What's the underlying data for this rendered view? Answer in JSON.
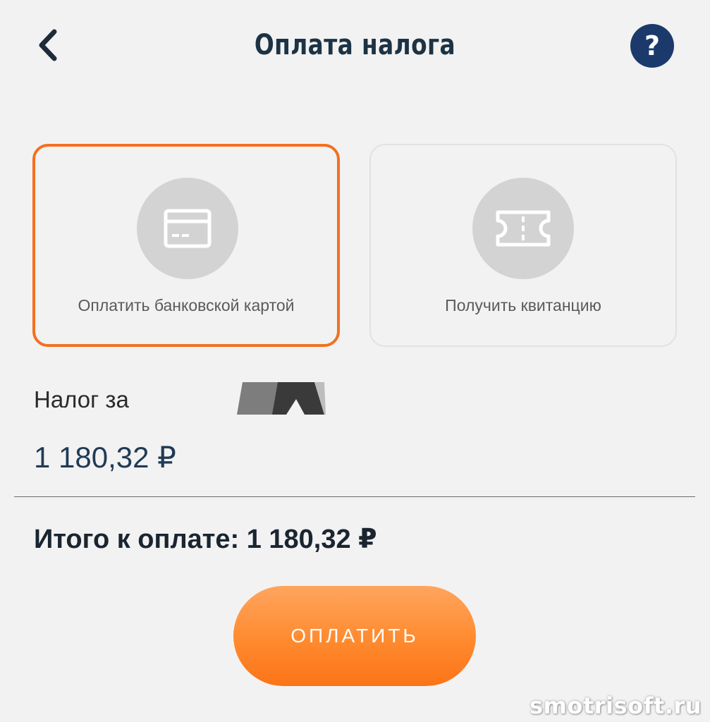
{
  "header": {
    "title": "Оплата налога",
    "help_label": "?"
  },
  "options": [
    {
      "label": "Оплатить банковской картой",
      "icon": "credit-card-icon",
      "selected": true
    },
    {
      "label": "Получить квитанцию",
      "icon": "ticket-icon",
      "selected": false
    }
  ],
  "tax": {
    "label": "Налог за",
    "amount": "1 180,32 ₽"
  },
  "total": {
    "text": "Итого к оплате: 1 180,32 ₽"
  },
  "pay_button": {
    "label": "ОПЛАТИТЬ"
  },
  "watermark": "smotrisoft.ru",
  "colors": {
    "accent": "#f37021",
    "help_button": "#1b3a6b",
    "background": "#f2f2f2"
  }
}
